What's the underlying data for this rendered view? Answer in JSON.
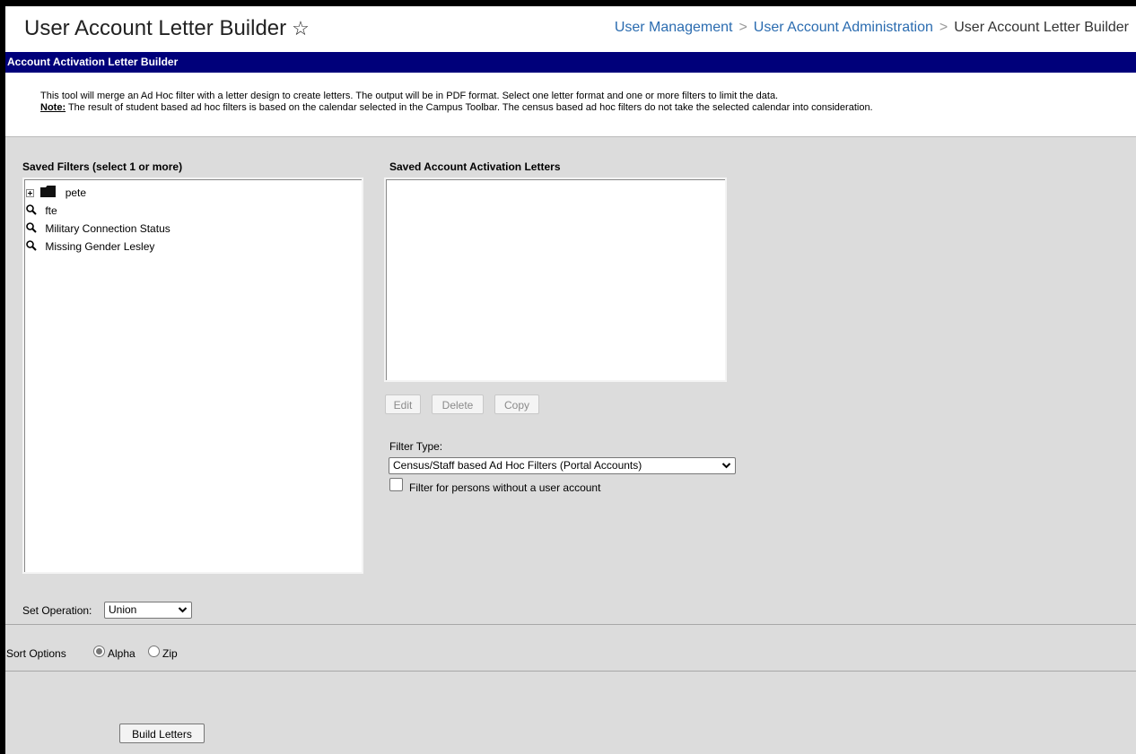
{
  "header": {
    "title": "User Account Letter Builder",
    "breadcrumb": [
      "User Management",
      "User Account Administration",
      "User Account Letter Builder"
    ]
  },
  "section_title": "Account Activation Letter Builder",
  "description": {
    "line1": "This tool will merge an Ad Hoc filter with a letter design to create letters. The output will be in PDF format. Select one letter format and one or more filters to limit the data.",
    "note_label": "Note:",
    "note_text": " The result of student based ad hoc filters is based on the calendar selected in the Campus Toolbar. The census based ad hoc filters do not take the selected calendar into consideration."
  },
  "saved_filters": {
    "label": "Saved Filters (select 1 or more)",
    "items": [
      {
        "label": "pete",
        "type": "folder"
      },
      {
        "label": "fte",
        "type": "filter"
      },
      {
        "label": "Military Connection Status",
        "type": "filter"
      },
      {
        "label": "Missing Gender Lesley",
        "type": "filter"
      }
    ]
  },
  "saved_letters": {
    "label": "Saved Account Activation Letters",
    "buttons": {
      "edit": "Edit",
      "delete": "Delete",
      "copy": "Copy"
    }
  },
  "filter_type": {
    "label": "Filter Type:",
    "selected": "Census/Staff based Ad Hoc Filters (Portal Accounts)",
    "checkbox_label": "Filter for persons without a user account",
    "checked": false
  },
  "set_operation": {
    "label": "Set Operation:",
    "selected": "Union"
  },
  "sort_options": {
    "label": "Sort Options",
    "options": [
      "Alpha",
      "Zip"
    ],
    "selected": "Alpha"
  },
  "build_button": "Build Letters",
  "colors": {
    "header_strip": "#00007a",
    "link": "#2b6cb0",
    "panel": "#dcdcdc"
  }
}
